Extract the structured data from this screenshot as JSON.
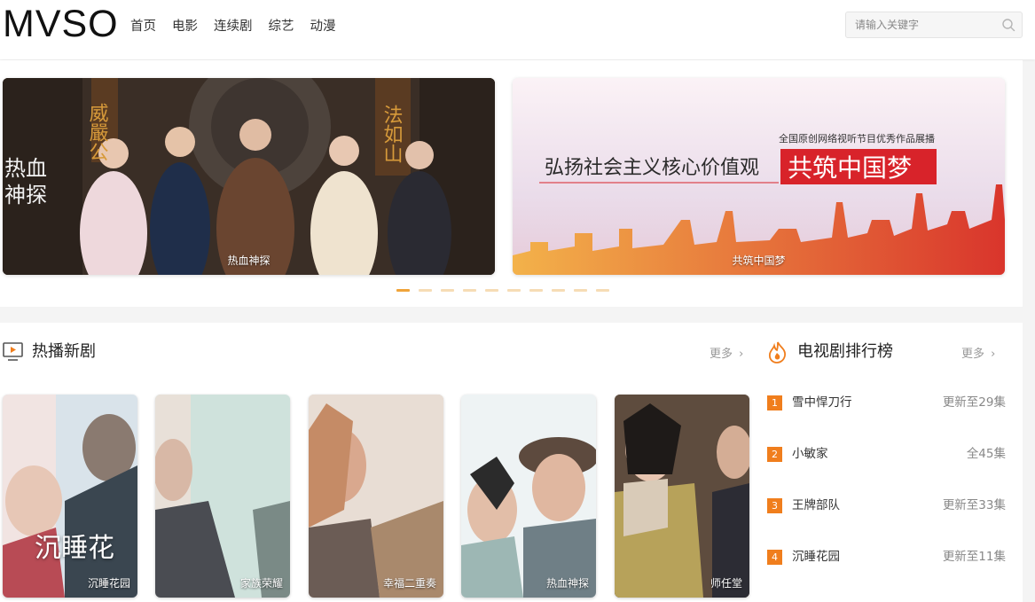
{
  "header": {
    "logo": "MVSO",
    "nav": [
      "首页",
      "电影",
      "连续剧",
      "综艺",
      "动漫"
    ],
    "search_placeholder": "请输入关键字"
  },
  "banner": {
    "slides": [
      {
        "caption": "热血神探",
        "poster_text": [
          "威嚴公",
          "热血",
          "神探",
          "法如山"
        ]
      },
      {
        "caption": "共筑中国梦",
        "subtitle": "全国原创网络视听节目优秀作品展播",
        "slogan": "弘扬社会主义核心价值观",
        "highlight": "共筑中国梦"
      }
    ],
    "dot_count": 10,
    "active_dot": 0
  },
  "hot_new": {
    "title": "热播新剧",
    "more": "更多",
    "cards": [
      {
        "caption": "沉睡花园",
        "poster_text": "沉睡花"
      },
      {
        "caption": "家族荣耀"
      },
      {
        "caption": "幸福二重奏"
      },
      {
        "caption": "热血神探"
      },
      {
        "caption": "师任堂"
      }
    ]
  },
  "ranking": {
    "title": "电视剧排行榜",
    "more": "更多",
    "items": [
      {
        "rank": "1",
        "name": "雪中悍刀行",
        "status": "更新至29集"
      },
      {
        "rank": "2",
        "name": "小敏家",
        "status": "全45集"
      },
      {
        "rank": "3",
        "name": "王牌部队",
        "status": "更新至33集"
      },
      {
        "rank": "4",
        "name": "沉睡花园",
        "status": "更新至11集"
      }
    ]
  },
  "colors": {
    "accent": "#f07e1d",
    "dot_active": "#f0a43a",
    "dot_inactive": "#f6dcb5",
    "slogan_red": "#d8232a"
  }
}
